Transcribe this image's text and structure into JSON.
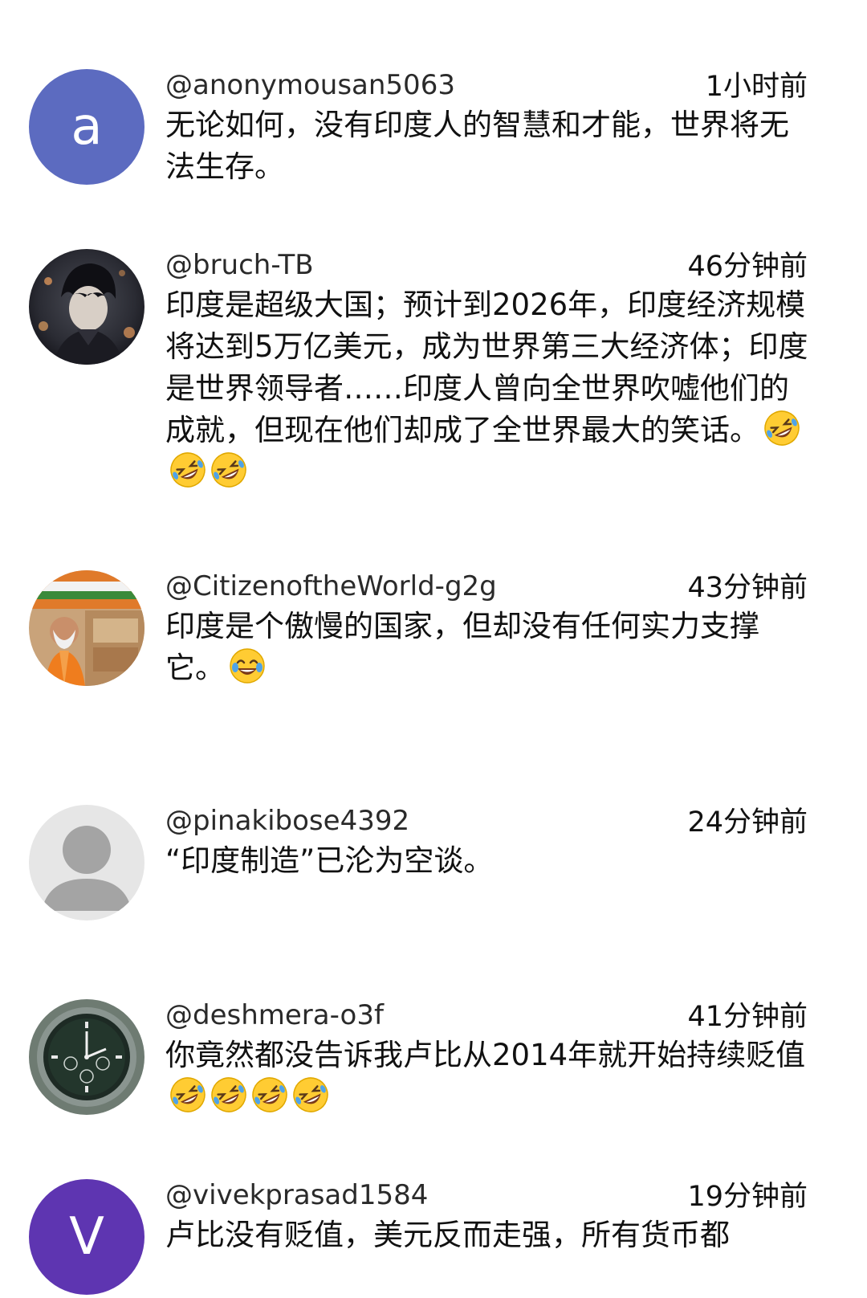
{
  "comments": [
    {
      "handle": "@anonymousan5063",
      "time": "1小时前",
      "text": "无论如何，没有印度人的智慧和才能，世界将无法生存。",
      "avatar": {
        "letter": "a",
        "color": "#5c6bc0"
      }
    },
    {
      "handle": "@bruch-TB",
      "time": "46分钟前",
      "text": "印度是超级大国；预计到2026年，印度经济规模将达到5万亿美元，成为世界第三大经济体；印度是世界领导者……印度人曾向全世界吹嘘他们的成就，但现在他们却成了全世界最大的笑话。",
      "emoji": [
        "rofl-emoji",
        "rofl-emoji",
        "rofl-emoji"
      ]
    },
    {
      "handle": "@CitizenoftheWorld-g2g",
      "time": "43分钟前",
      "text": "印度是个傲慢的国家，但却没有任何实力支撑它。",
      "emoji": [
        "joy-emoji"
      ]
    },
    {
      "handle": "@pinakibose4392",
      "time": "24分钟前",
      "text": "“印度制造”已沦为空谈。"
    },
    {
      "handle": "@deshmera-o3f",
      "time": "41分钟前",
      "text": "你竟然都没告诉我卢比从2014年就开始持续贬值",
      "emoji": [
        "rofl-emoji",
        "rofl-emoji",
        "rofl-emoji",
        "rofl-emoji"
      ]
    },
    {
      "handle": "@vivekprasad1584",
      "time": "19分钟前",
      "text": "卢比没有贬值，美元反而走强，所有货币都",
      "avatar": {
        "letter": "V",
        "color": "#5e35b1"
      }
    }
  ]
}
